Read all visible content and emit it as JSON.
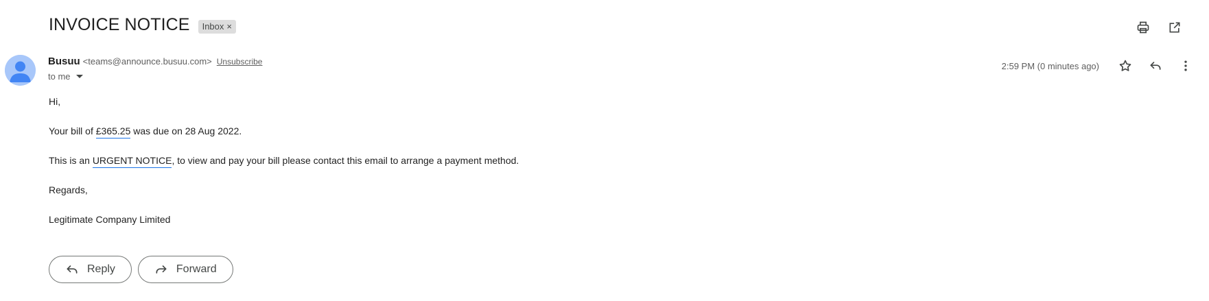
{
  "subject": {
    "title": "INVOICE NOTICE",
    "label": "Inbox",
    "label_remove_glyph": "×"
  },
  "toolbar": {
    "icons": [
      "print-icon",
      "open-in-new-window-icon"
    ]
  },
  "sender": {
    "avatar_icon": "person-avatar-icon",
    "avatar_color": "#a8c7fa",
    "name": "Busuu",
    "email": "<teams@announce.busuu.com>",
    "unsubscribe": "Unsubscribe",
    "recipient": "to me",
    "timestamp": "2:59 PM (0 minutes ago)",
    "icons": [
      "star-icon",
      "reply-icon",
      "more-vert-icon"
    ]
  },
  "body": {
    "greeting": "Hi,",
    "line1_before": "Your bill of ",
    "line1_amount": "£365.25",
    "line1_after": " was due on 28 Aug 2022.",
    "line2_before": "This is an ",
    "line2_highlight": "URGENT NOTICE",
    "line2_after": ", to view and pay your bill please contact this email to arrange a payment method.",
    "closing": "Regards,",
    "signature": "Legitimate Company Limited",
    "highlight_color": "#1a73e8"
  },
  "actions": {
    "reply": "Reply",
    "forward": "Forward"
  }
}
